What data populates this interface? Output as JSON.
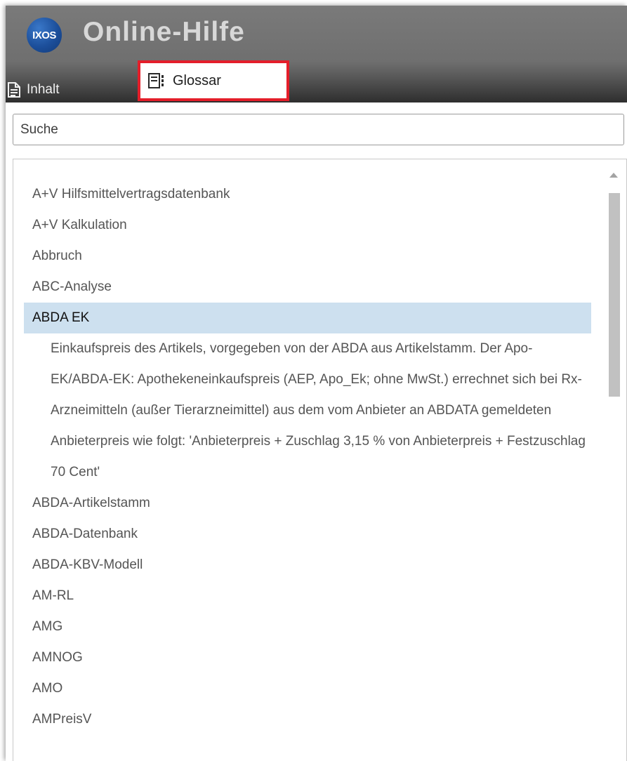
{
  "header": {
    "logo_text": "IXOS",
    "title": "Online-Hilfe"
  },
  "tabs": {
    "inhalt": {
      "label": "Inhalt",
      "icon": "document-list-icon"
    },
    "glossar": {
      "label": "Glossar",
      "icon": "glossary-book-icon",
      "active": true
    }
  },
  "search": {
    "placeholder": "Suche",
    "value": ""
  },
  "glossary": {
    "items_before": [
      "A+V Hilfsmittelvertragsdatenbank",
      "A+V Kalkulation",
      "Abbruch",
      "ABC-Analyse"
    ],
    "selected": {
      "term": "ABDA EK",
      "definition": "Einkaufspreis des Artikels, vorgegeben von der ABDA aus Artikelstamm. Der Apo-EK/ABDA-EK: Apothekeneinkaufspreis (AEP, Apo_Ek; ohne MwSt.) errechnet sich bei Rx-Arzneimitteln (außer Tierarzneimittel) aus dem vom Anbieter an ABDATA gemeldeten Anbieterpreis wie folgt: 'Anbieterpreis + Zuschlag 3,15 % von Anbieterpreis + Festzuschlag 70 Cent'"
    },
    "items_after": [
      "ABDA-Artikelstamm",
      "ABDA-Datenbank",
      "ABDA-KBV-Modell",
      "AM-RL",
      "AMG",
      "AMNOG",
      "AMO",
      "AMPreisV"
    ]
  },
  "colors": {
    "highlight_border": "#e41e2a",
    "selected_row": "#cde0ef",
    "header_bg": "#6f6f6f"
  }
}
